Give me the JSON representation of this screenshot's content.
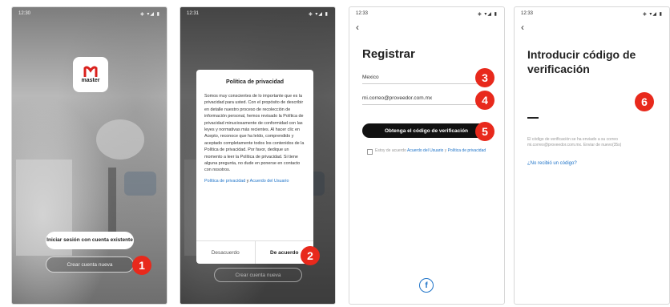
{
  "phone1": {
    "time": "12:30",
    "status_icons": "◈ ▾◢ ▮",
    "logo_text": "master",
    "login_label": "Iniciar sesión con cuenta existente",
    "create_label": "Crear cuenta nueva",
    "badge": "1"
  },
  "phone2": {
    "time": "12:31",
    "status_icons": "◈ ▾◢ ▮",
    "title": "Política de privacidad",
    "body": "Somos muy conscientes de lo importante que es la privacidad para usted. Con el propósito de describir en detalle nuestro proceso de recolección de información personal, hemos revisado la Política de privacidad minuciosamente de conformidad con las leyes y normativas más recientes. Al hacer clic en Acepto, reconoce que ha leído, comprendido y aceptado completamente todos los contenidos de la Política de privacidad. Por favor, dedique un momento a leer la Política de privacidad. Si tiene alguna pregunta, no dude en ponerse en contacto con nosotros.",
    "link1": "Política de privacidad",
    "and": " y ",
    "link2": "Acuerdo del Usuario",
    "disagree": "Desacuerdo",
    "agree": "De acuerdo",
    "behind_button": "Crear cuenta nueva",
    "badge": "2"
  },
  "phone3": {
    "time": "12:33",
    "status_icons": "◈ ▾◢ ▮",
    "back": "‹",
    "title": "Registrar",
    "country": "Mexico",
    "email": "mi.correo@proveedor.com.mx",
    "code_button": "Obtenga el código de verificación",
    "agree_prefix": "Estoy de acuerdo ",
    "agree_link1": "Acuerdo del Usuario",
    "agree_mid": " y ",
    "agree_link2": "Política de privacidad",
    "facebook": "f",
    "badge3": "3",
    "badge4": "4",
    "badge5": "5"
  },
  "phone4": {
    "time": "12:33",
    "status_icons": "◈ ▾◢ ▮",
    "back": "‹",
    "title": "Introducir código de verificación",
    "info": "El código de verificación se ha enviado a su correo mi.correo@proveedor.com.mx. Enviar de nuevo(35s)",
    "no_code": "¿No recibió un código?",
    "badge": "6"
  },
  "colors": {
    "badge": "#e8291c",
    "link": "#1e73c8",
    "logo_red": "#d9201c"
  },
  "icons": [
    "back-icon",
    "facebook-icon",
    "wifi-icon",
    "battery-icon"
  ]
}
